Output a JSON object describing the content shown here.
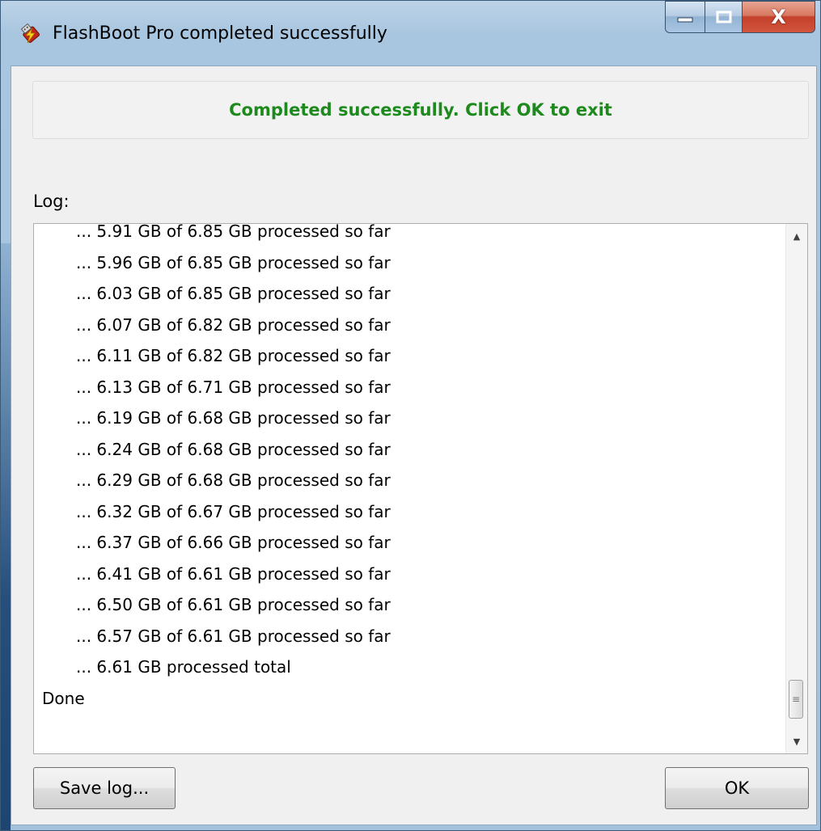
{
  "window": {
    "title": "FlashBoot Pro completed successfully",
    "close_glyph": "X"
  },
  "status": {
    "message": "Completed successfully. Click OK to exit",
    "color": "#1e8a1e"
  },
  "log": {
    "label": "Log:",
    "lines": [
      "... 5.91 GB of 6.85 GB processed so far",
      "... 5.96 GB of 6.85 GB processed so far",
      "... 6.03 GB of 6.85 GB processed so far",
      "... 6.07 GB of 6.82 GB processed so far",
      "... 6.11 GB of 6.82 GB processed so far",
      "... 6.13 GB of 6.71 GB processed so far",
      "... 6.19 GB of 6.68 GB processed so far",
      "... 6.24 GB of 6.68 GB processed so far",
      "... 6.29 GB of 6.68 GB processed so far",
      "... 6.32 GB of 6.67 GB processed so far",
      "... 6.37 GB of 6.66 GB processed so far",
      "... 6.41 GB of 6.61 GB processed so far",
      "... 6.50 GB of 6.61 GB processed so far",
      "... 6.57 GB of 6.61 GB processed so far",
      "... 6.61 GB processed total",
      "Done"
    ]
  },
  "buttons": {
    "save_log": "Save log...",
    "ok": "OK"
  },
  "icons": {
    "app": "flashboot-usb-icon",
    "minimize": "minimize-icon",
    "maximize": "maximize-icon",
    "close": "close-icon",
    "scroll_up": "scroll-up-arrow-icon",
    "scroll_down": "scroll-down-arrow-icon"
  }
}
